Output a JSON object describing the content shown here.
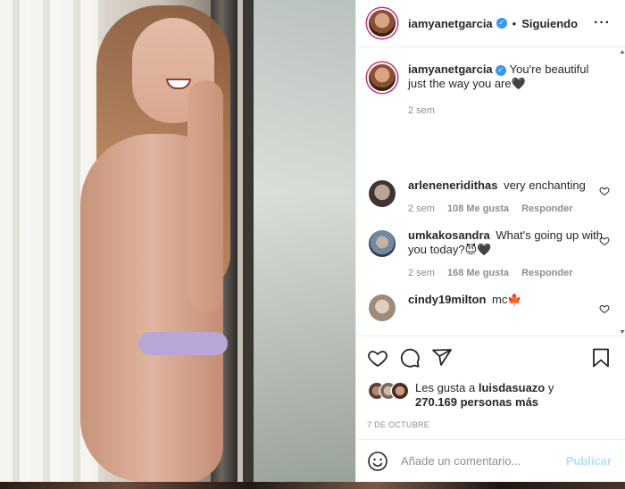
{
  "post": {
    "username": "iamyanetgarcia",
    "follow_status": "Siguiendo",
    "caption": "You're beautiful just the way you are🖤",
    "caption_time": "2 sem"
  },
  "comments": [
    {
      "username": "arleneneridithas",
      "text": "very enchanting",
      "time": "2 sem",
      "likes": "108 Me gusta",
      "reply": "Responder"
    },
    {
      "username": "umkakosandra",
      "text": "What's going up with you today?😈🖤",
      "time": "2 sem",
      "likes": "168 Me gusta",
      "reply": "Responder"
    },
    {
      "username": "cindy19milton",
      "text": "mc🍁",
      "time": "",
      "likes": "",
      "reply": ""
    }
  ],
  "likes": {
    "prefix": "Les gusta a",
    "user": "luisdasuazo",
    "connector": "y",
    "others": "270.169 personas más"
  },
  "date": "7 DE OCTUBRE",
  "add_comment": {
    "placeholder": "Añade un comentario...",
    "post_label": "Publicar"
  },
  "icons": {
    "like": "heart-icon",
    "comment": "comment-icon",
    "share": "share-icon",
    "save": "bookmark-icon",
    "emoji": "emoji-icon",
    "more": "more-icon",
    "verified": "verified-badge-icon"
  },
  "colors": {
    "verified": "#3897f0",
    "muted": "#8e8e8e",
    "post_button": "#b2dffc"
  }
}
